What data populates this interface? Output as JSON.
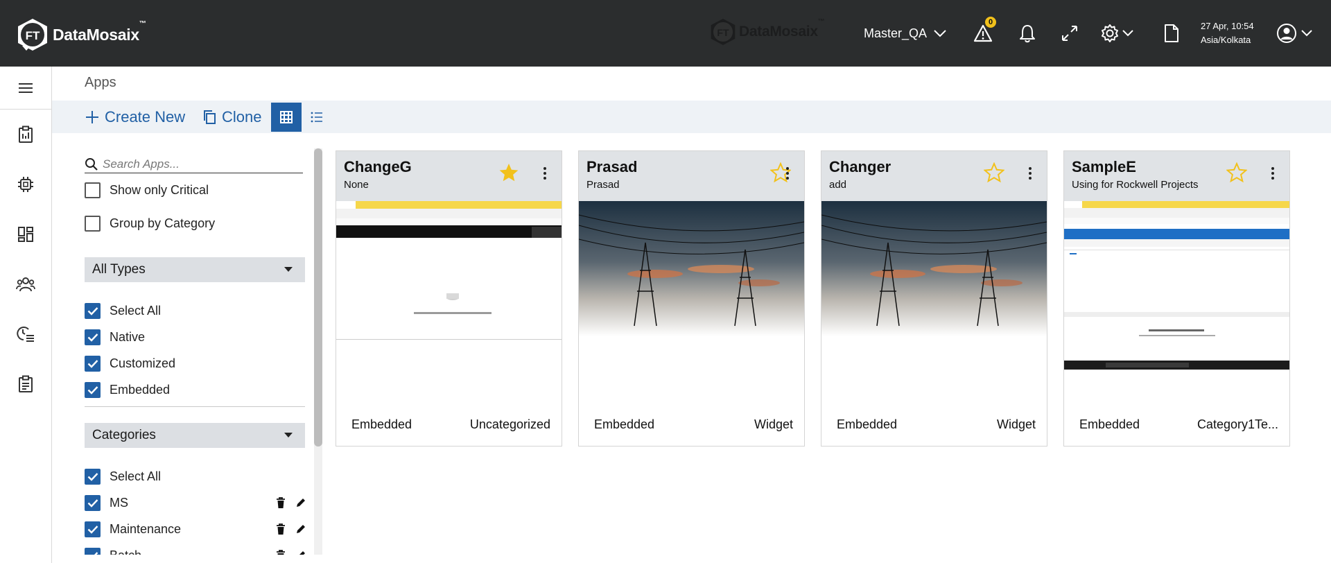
{
  "brand": {
    "name": "DataMosaix",
    "tm": "™",
    "mark": "FT"
  },
  "topbar": {
    "workspace": "Master_QA",
    "alert_count": "0",
    "date": "27 Apr, 10:54",
    "timezone": "Asia/Kolkata",
    "icons": [
      "warning-icon",
      "bell-icon",
      "expand-icon",
      "gear-icon",
      "document-icon",
      "user-icon"
    ]
  },
  "rail": {
    "items": [
      "menu-icon",
      "clipboard-icon",
      "chip-icon",
      "dashboard-icon",
      "users-icon",
      "history-list-icon",
      "checklist-icon"
    ]
  },
  "page": {
    "title": "Apps"
  },
  "toolbar": {
    "create_label": "Create New",
    "clone_label": "Clone"
  },
  "filters": {
    "search_placeholder": "Search Apps...",
    "show_critical": "Show only Critical",
    "group_by_category": "Group by Category",
    "types_label": "All Types",
    "types": [
      {
        "label": "Select All",
        "checked": true
      },
      {
        "label": "Native",
        "checked": true
      },
      {
        "label": "Customized",
        "checked": true
      },
      {
        "label": "Embedded",
        "checked": true
      }
    ],
    "categories_label": "Categories",
    "categories": [
      {
        "label": "Select All",
        "checked": true
      },
      {
        "label": "MS",
        "checked": true
      },
      {
        "label": "Maintenance",
        "checked": true
      },
      {
        "label": "Batch",
        "checked": true
      }
    ]
  },
  "cards": [
    {
      "title": "ChangeG",
      "subtitle": "None",
      "favorite": true,
      "type": "Embedded",
      "category": "Uncategorized",
      "preview": "browser-screenshot"
    },
    {
      "title": "Prasad",
      "subtitle": "Prasad",
      "favorite": false,
      "type": "Embedded",
      "category": "Widget",
      "preview": "power-lines-photo"
    },
    {
      "title": "Changer",
      "subtitle": "add",
      "favorite": false,
      "type": "Embedded",
      "category": "Widget",
      "preview": "power-lines-photo"
    },
    {
      "title": "SampleE",
      "subtitle": "Using for Rockwell Projects",
      "favorite": false,
      "type": "Embedded",
      "category": "Category1Te...",
      "preview": "browser-screenshot"
    }
  ],
  "colors": {
    "topbar": "#2b2d2e",
    "accent": "#2160a5",
    "star": "#f2c11b",
    "badge": "#f2c11b"
  }
}
